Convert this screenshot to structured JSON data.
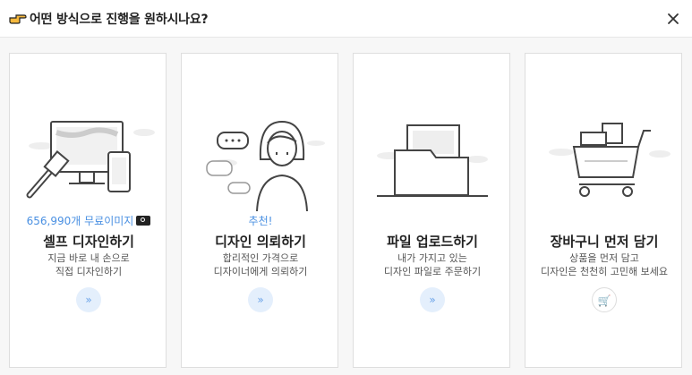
{
  "header": {
    "title": "어떤 방식으로 진행을 원하시나요?",
    "close_icon": "close-icon",
    "hand_icon": "pointing-hand-icon"
  },
  "cards": [
    {
      "badge": "656,990개 무료이미지",
      "title": "셀프 디자인하기",
      "desc1": "지금 바로 내 손으로",
      "desc2": "직접 디자인하기",
      "action": "»"
    },
    {
      "badge": "추천!",
      "title": "디자인 의뢰하기",
      "desc1": "합리적인 가격으로",
      "desc2": "디자이너에게 의뢰하기",
      "action": "»"
    },
    {
      "title": "파일 업로드하기",
      "desc1": "내가 가지고 있는",
      "desc2": "디자인 파일로 주문하기",
      "action": "»"
    },
    {
      "title": "장바구니 먼저 담기",
      "desc1": "상품을 먼저 담고",
      "desc2": "디자인은 천천히 고민해 보세요",
      "action": "🛒"
    }
  ],
  "colors": {
    "accent": "#4a90e2",
    "action_bg": "#e4effc"
  }
}
